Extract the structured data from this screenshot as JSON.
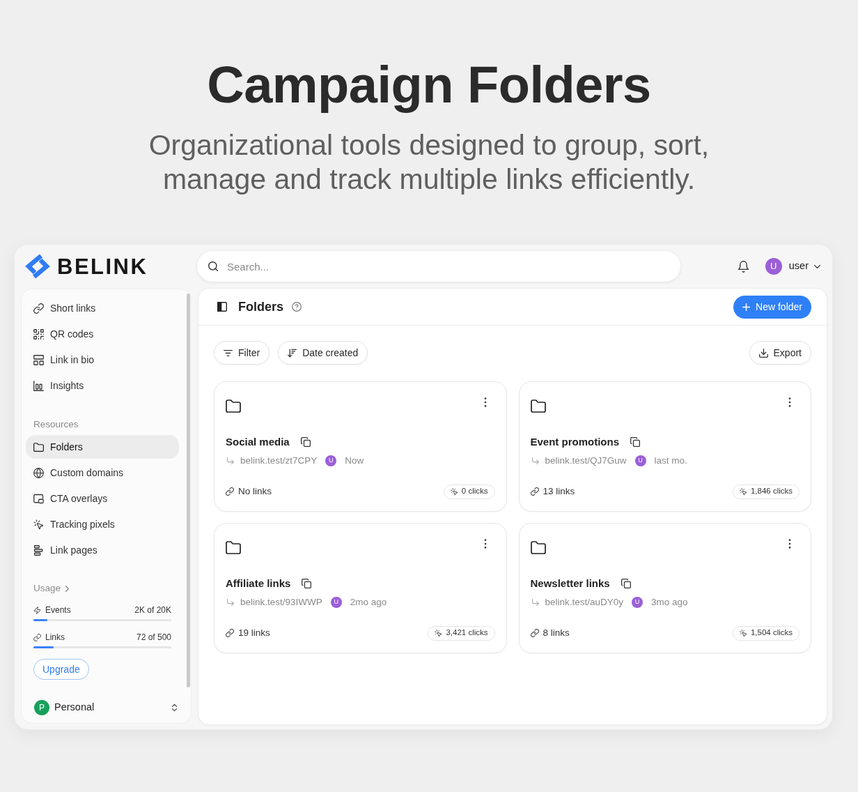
{
  "hero": {
    "title": "Campaign Folders",
    "subtitle": "Organizational tools designed to group, sort, manage and track multiple links efficiently."
  },
  "header": {
    "logo": "BELINK",
    "search": {
      "placeholder": "Search..."
    },
    "user": {
      "avatar": "U",
      "name": "user"
    }
  },
  "sidebar": {
    "nav": [
      {
        "label": "Short links",
        "selected": false
      },
      {
        "label": "QR codes",
        "selected": false
      },
      {
        "label": "Link in bio",
        "selected": false
      },
      {
        "label": "Insights",
        "selected": false
      }
    ],
    "resources": {
      "heading": "Resources",
      "items": [
        {
          "label": "Folders",
          "selected": true
        },
        {
          "label": "Custom domains",
          "selected": false
        },
        {
          "label": "CTA overlays",
          "selected": false
        },
        {
          "label": "Tracking pixels",
          "selected": false
        },
        {
          "label": "Link pages",
          "selected": false
        }
      ]
    },
    "usage": {
      "heading": "Usage",
      "meters": [
        {
          "label": "Events",
          "reading": "2K of 20K",
          "level": 0.1
        },
        {
          "label": "Links",
          "reading": "72 of 500",
          "level": 0.144
        }
      ],
      "upgrade": "Upgrade"
    },
    "workspace": {
      "avatar": "P",
      "name": "Personal"
    }
  },
  "page": {
    "title": "Folders",
    "new_button": "New folder",
    "toolbar": {
      "filter": "Filter",
      "sort": "Date created",
      "export": "Export"
    },
    "folders": [
      {
        "name": "Social media",
        "short_link": "belink.test/zt7CPY",
        "owner": "U",
        "time": "Now",
        "links": "No links",
        "clicks": "0 clicks"
      },
      {
        "name": "Event promotions",
        "short_link": "belink.test/QJ7Guw",
        "owner": "U",
        "time": "last mo.",
        "links": "13 links",
        "clicks": "1,846 clicks"
      },
      {
        "name": "Affiliate links",
        "short_link": "belink.test/93IWWP",
        "owner": "U",
        "time": "2mo ago",
        "links": "19 links",
        "clicks": "3,421 clicks"
      },
      {
        "name": "Newsletter links",
        "short_link": "belink.test/auDY0y",
        "owner": "U",
        "time": "3mo ago",
        "links": "8 links",
        "clicks": "1,504 clicks"
      }
    ]
  }
}
